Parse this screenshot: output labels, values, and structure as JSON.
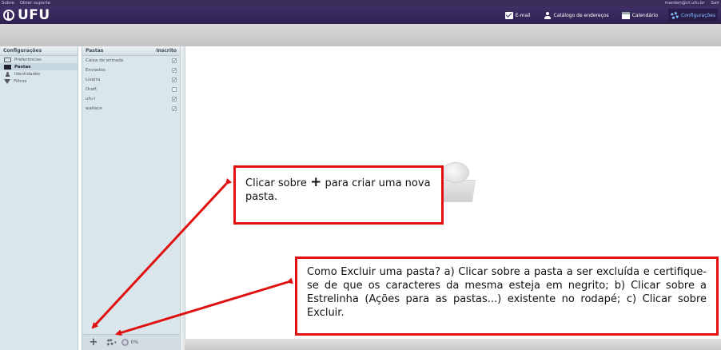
{
  "topstrip": {
    "links": [
      "Sobre",
      "Obter suporte"
    ],
    "user": "marden@ct.ufu.br",
    "logout": "Sair"
  },
  "header": {
    "logo": "UFU",
    "nav": [
      {
        "label": "E-mail",
        "icon": "mail-icon"
      },
      {
        "label": "Catálogo de endereços",
        "icon": "person-icon"
      },
      {
        "label": "Calendário",
        "icon": "calendar-icon"
      },
      {
        "label": "Configurações",
        "icon": "gear-icon",
        "active": true
      }
    ]
  },
  "settings": {
    "title": "Configurações",
    "items": [
      {
        "label": "Preferências",
        "icon": "preferences-icon"
      },
      {
        "label": "Pastas",
        "icon": "folder-icon",
        "selected": true
      },
      {
        "label": "Identidades",
        "icon": "identity-icon"
      },
      {
        "label": "Filtros",
        "icon": "filter-icon"
      }
    ]
  },
  "folders": {
    "title": "Pastas",
    "subscribed_header": "Inscrito",
    "rows": [
      {
        "name": "Caixa de entrada",
        "mark": "✓"
      },
      {
        "name": "Enviados",
        "mark": "✓"
      },
      {
        "name": "Lixeira",
        "mark": "✓"
      },
      {
        "name": "Draft",
        "mark": ""
      },
      {
        "name": "ufu-l",
        "mark": "✓"
      },
      {
        "name": "wallace",
        "mark": "✓"
      }
    ],
    "footer": {
      "add": "+",
      "quota": "0%"
    }
  },
  "callouts": {
    "create_before": "Clicar sobre",
    "create_plus": "+",
    "create_after": "para criar uma nova pasta.",
    "delete_text": "Como Excluir uma pasta? a) Clicar sobre a pasta a ser excluída e certifique-se de que os caracteres da mesma esteja em negrito; b) Clicar sobre a Estrelinha (Ações para as pastas...) existente no rodapé; c) Clicar sobre Excluir."
  },
  "colors": {
    "header": "#3f2f66",
    "panel": "#d9e6ec",
    "active_nav": "#7fc3ff",
    "callout_border": "#e01010"
  }
}
